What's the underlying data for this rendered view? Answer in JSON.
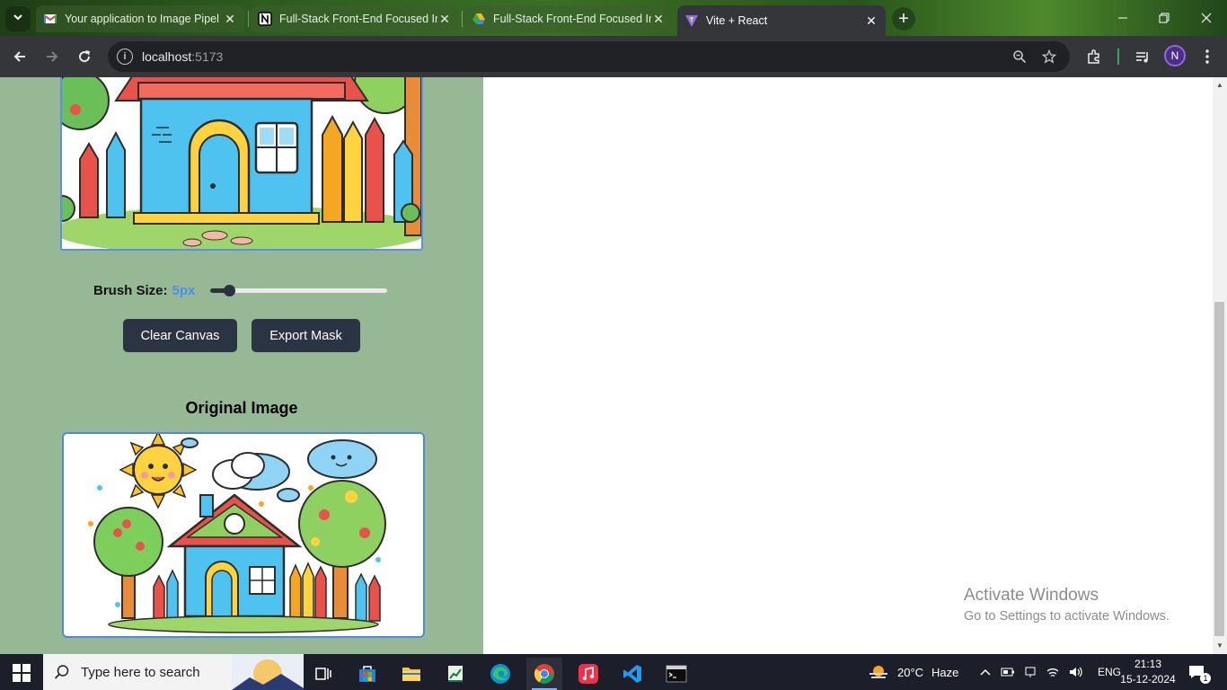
{
  "browser": {
    "tabs": [
      {
        "title": "Your application to Image Pipel",
        "favicon": "gmail-icon",
        "active": false
      },
      {
        "title": "Full-Stack Front-End Focused In",
        "favicon": "notion-icon",
        "active": false
      },
      {
        "title": "Full-Stack Front-End Focused In",
        "favicon": "drive-icon",
        "active": false
      },
      {
        "title": "Vite + React",
        "favicon": "vite-icon",
        "active": true
      }
    ],
    "close_glyph": "✕",
    "new_tab_glyph": "+",
    "address": {
      "host": "localhost",
      "port": ":5173"
    },
    "avatar_initial": "N"
  },
  "app": {
    "brush": {
      "label": "Brush Size:",
      "value_text": "5px",
      "value": 5,
      "min": 1,
      "max": 50
    },
    "buttons": {
      "clear": "Clear Canvas",
      "export": "Export Mask"
    },
    "original_title": "Original Image"
  },
  "watermark": {
    "line1": "Activate Windows",
    "line2": "Go to Settings to activate Windows."
  },
  "taskbar": {
    "search_placeholder": "Type here to search",
    "weather": {
      "temp": "20°C",
      "condition": "Haze"
    },
    "language": "ENG",
    "time": "21:13",
    "date": "15-12-2024",
    "notifications": "1"
  },
  "colors": {
    "panel_bg": "#97b895",
    "button_bg": "#2b3443",
    "accent_blue": "#4f8cf2"
  }
}
